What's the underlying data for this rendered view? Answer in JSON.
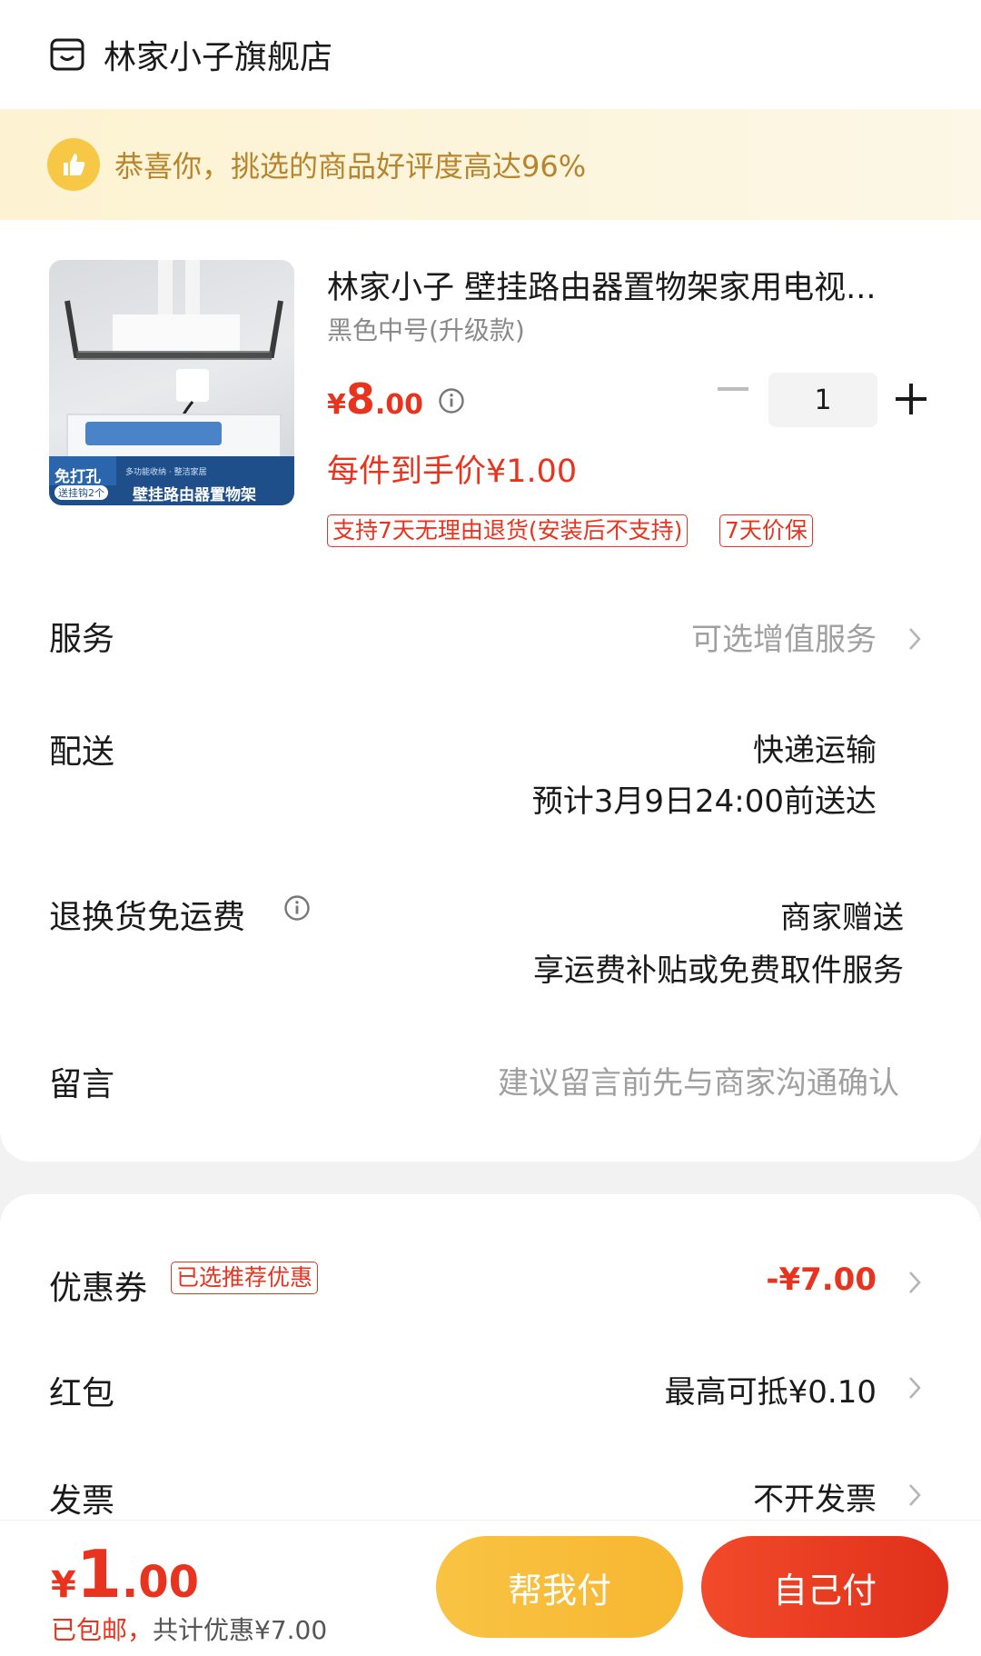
{
  "store": {
    "name": "林家小子旗舰店",
    "icon": "shop-icon"
  },
  "banner": {
    "text": "恭喜你，挑选的商品好评度高达96%",
    "icon": "thumbs-up-icon"
  },
  "product": {
    "image_badges": [
      "免打孔",
      "送挂钩2个",
      "多功能收纳 · 整洁家居",
      "壁挂路由器置物架"
    ],
    "title": "林家小子 壁挂路由器置物架家用电视...",
    "spec": "黑色中号(升级款)",
    "price_symbol": "¥",
    "price_int": "8",
    "price_dec": ".00",
    "quantity": "1",
    "unit_price_text": "每件到手价¥1.00",
    "tags": [
      "支持7天无理由退货(安装后不支持)",
      "7天价保"
    ]
  },
  "rows": {
    "service": {
      "label": "服务",
      "value": "可选增值服务"
    },
    "delivery": {
      "label": "配送",
      "value1": "快递运输",
      "value2": "预计3月9日24:00前送达"
    },
    "return_shipping": {
      "label": "退换货免运费",
      "value1": "商家赠送",
      "value2": "享运费补贴或免费取件服务"
    },
    "message": {
      "label": "留言",
      "placeholder": "建议留言前先与商家沟通确认"
    },
    "coupon": {
      "label": "优惠券",
      "tag": "已选推荐优惠",
      "value": "-¥7.00"
    },
    "red_packet": {
      "label": "红包",
      "value": "最高可抵¥0.10"
    },
    "invoice": {
      "label": "发票",
      "value": "不开发票"
    }
  },
  "bottom": {
    "total_symbol": "¥",
    "total_int": "1",
    "total_dec": ".00",
    "note_free": "已包邮，",
    "note_discount": "共计优惠¥7.00",
    "btn_help": "帮我付",
    "btn_self": "自己付"
  },
  "colors": {
    "accent": "#e8331f",
    "banner_text": "#b8842c",
    "help_btn": "#f7b731",
    "self_btn": "#e8331f"
  }
}
